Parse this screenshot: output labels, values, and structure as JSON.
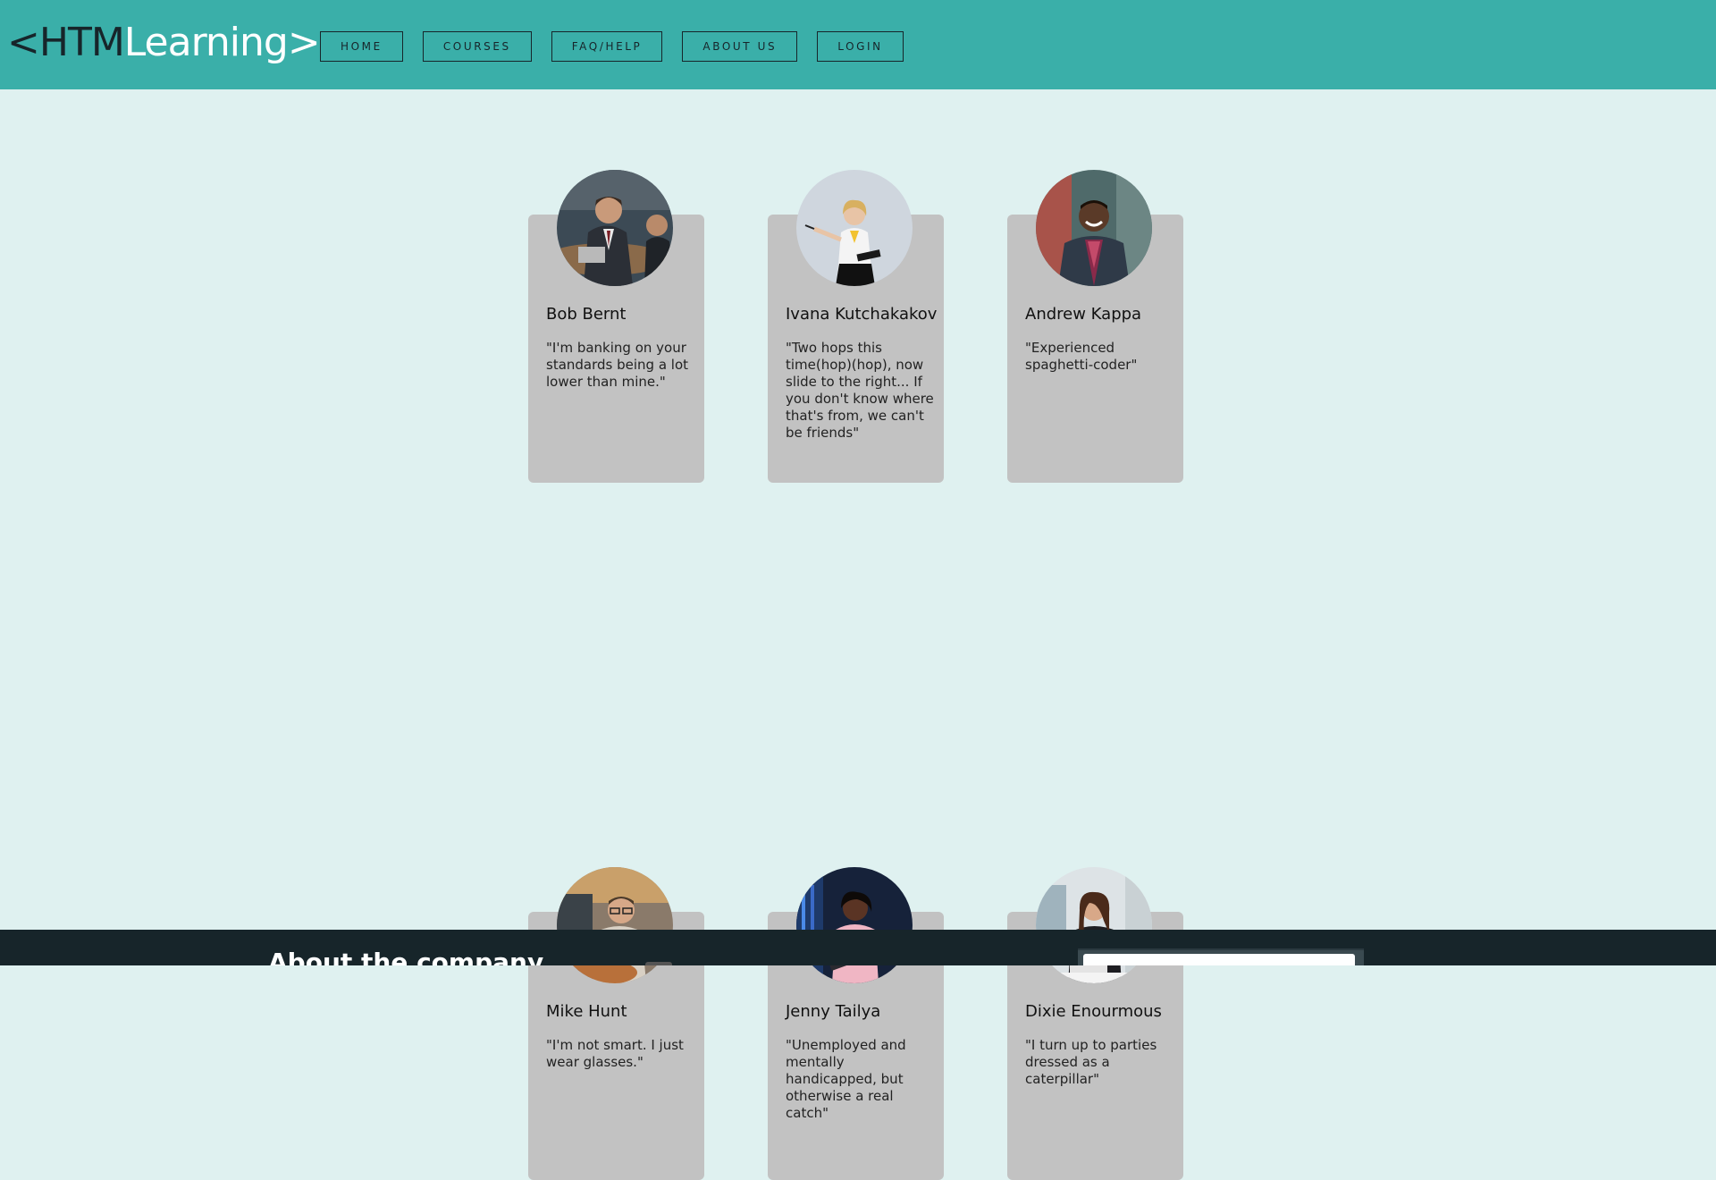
{
  "header": {
    "logo": {
      "prefix": "<HTM",
      "suffix": "Learning>"
    },
    "nav": [
      {
        "label": "HOME"
      },
      {
        "label": "COURSES"
      },
      {
        "label": "FAQ/HELP"
      },
      {
        "label": "ABOUT US"
      },
      {
        "label": "LOGIN"
      }
    ]
  },
  "team": [
    {
      "name": "Bob Bernt",
      "quote": "\"I'm banking on your standards being a lot lower than mine.\"",
      "photo": "man-in-suit-at-meeting-photo"
    },
    {
      "name": "Ivana Kutchakakov",
      "quote": "\"Two hops this time(hop)(hop), now slide to the right... If you don't know where that's from, we can't be friends\"",
      "photo": "woman-presenting-with-pointer-photo"
    },
    {
      "name": "Andrew Kappa",
      "quote": "\"Experienced spaghetti-coder\"",
      "photo": "smiling-man-in-blazer-photo"
    },
    {
      "name": "Mike Hunt",
      "quote": "\"I'm not smart. I just wear glasses.\"",
      "photo": "man-with-glasses-at-laptop-photo"
    },
    {
      "name": "Jenny Tailya",
      "quote": "\"Unemployed and mentally handicapped, but otherwise a real catch\"",
      "photo": "woman-with-tablet-in-server-room-photo"
    },
    {
      "name": "Dixie Enourmous",
      "quote": "\"I turn up to parties dressed as a caterpillar\"",
      "photo": "woman-at-desk-with-laptop-photo"
    }
  ],
  "footer": {
    "title": "About the company"
  },
  "colors": {
    "header_bg": "#3aafa9",
    "page_bg": "#dff1f0",
    "card_bg": "#c2c2c2",
    "footer_bg": "#17252a",
    "text_dark": "#17252a"
  }
}
